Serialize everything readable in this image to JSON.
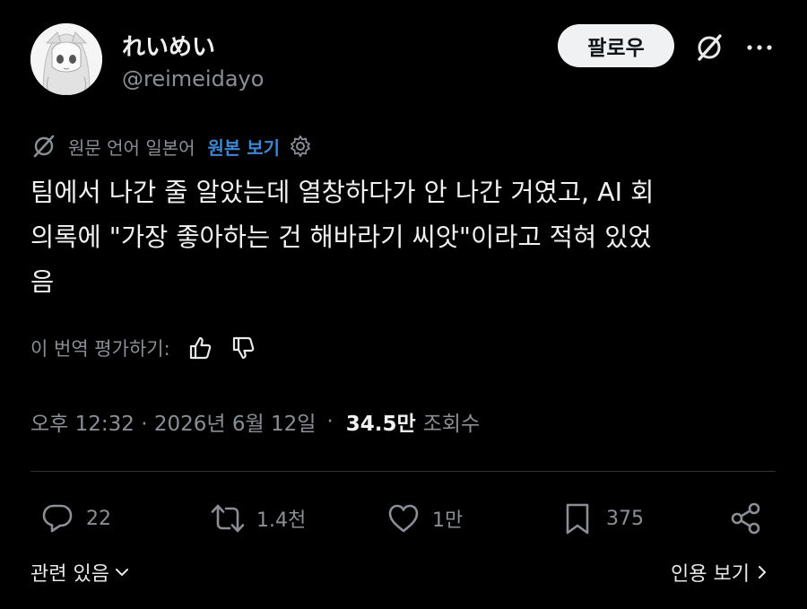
{
  "author": {
    "name": "れいめい",
    "handle": "@reimeidayo",
    "follow_label": "팔로우"
  },
  "translation": {
    "original_language": "원문 언어 일본어",
    "show_original": "원본 보기"
  },
  "post": {
    "line1": "팀에서 나간 줄 알았는데 열창하다가 안 나간 거였고, AI 회",
    "line2": "의록에 \"가장 좋아하는 건 해바라기 씨앗\"이라고 적혀 있었",
    "line3": "음"
  },
  "rating": {
    "label": "이 번역 평가하기:"
  },
  "meta": {
    "time": "오후 12:32 · 2026년 6월 12일",
    "separator": "·",
    "views_count": "34.5만",
    "views_label": "조회수"
  },
  "actions": {
    "replies": "22",
    "reposts": "1.4천",
    "likes": "1만",
    "bookmarks": "375"
  },
  "footer": {
    "related": "관련 있음",
    "view_quotes": "인용 보기"
  },
  "icons": {
    "grok": "grok-icon",
    "more": "more-icon",
    "translate": "translate-icon",
    "settings": "gear-icon",
    "thumbs_up": "thumbs-up-icon",
    "thumbs_down": "thumbs-down-icon",
    "reply": "reply-icon",
    "repost": "repost-icon",
    "like": "heart-icon",
    "bookmark": "bookmark-icon",
    "share": "share-icon"
  },
  "colors": {
    "background": "#000000",
    "text": "#e7e9ea",
    "muted": "#8b8f95",
    "link": "#3e86d1",
    "divider": "#2f3336"
  }
}
